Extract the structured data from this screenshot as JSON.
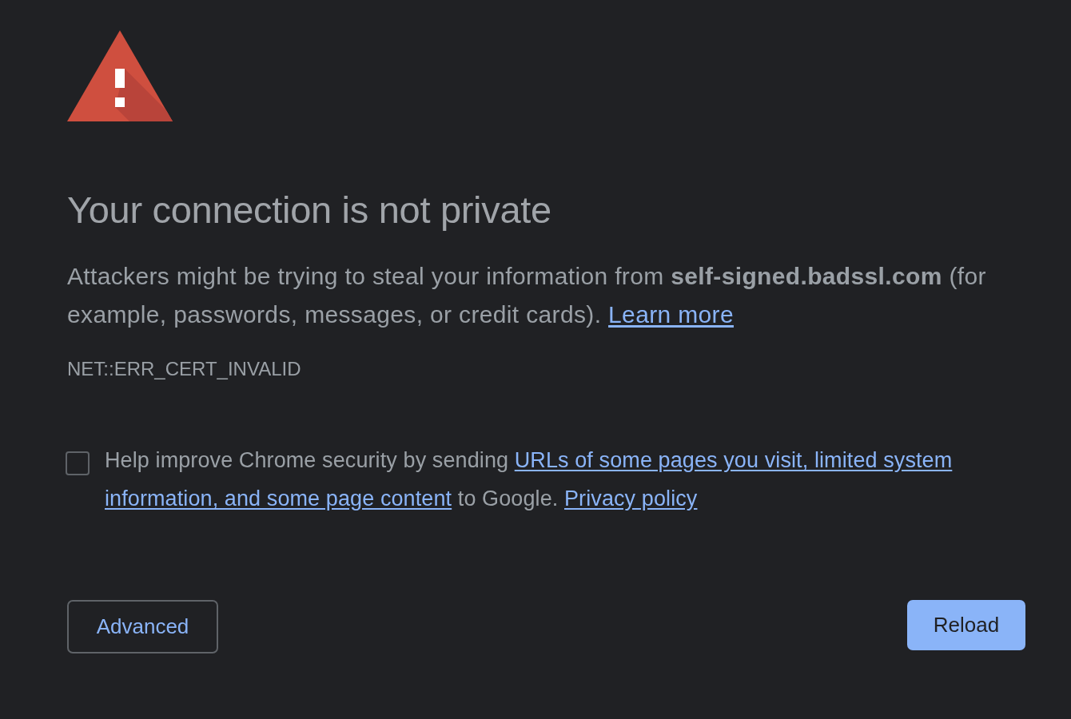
{
  "heading": "Your connection is not private",
  "message": {
    "text": "Attackers might be trying to steal your information from **self-signed.badssl.com** (for example, passwords, messages, or credit cards).",
    "link": "Learn more"
  },
  "error_code": "NET::ERR_CERT_INVALID",
  "opt_in": {
    "checked": false,
    "lines": [
      [
        {
          "kind": "text",
          "text": "Help improve Chrome security by sending"
        },
        {
          "kind": "link",
          "text": "URLs of some pages you visit, limited system"
        }
      ],
      [
        {
          "kind": "link",
          "text": "information, and some page content"
        },
        {
          "kind": "text",
          "text": "to Google."
        },
        {
          "kind": "link",
          "text": "Privacy policy"
        }
      ]
    ]
  },
  "buttons": [
    {
      "label": "Advanced",
      "kind": "outline"
    },
    {
      "label": "Reload",
      "kind": "filled"
    }
  ]
}
